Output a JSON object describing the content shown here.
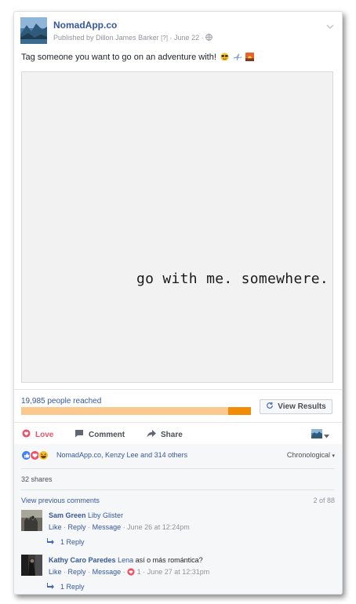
{
  "post": {
    "page_name": "NomadApp.co",
    "published_prefix": "Published by",
    "author": "Dillon James Barker",
    "author_help": "[?]",
    "date": "June 22",
    "separator": "·",
    "text": "Tag someone you want to go on an adventure with!",
    "image_caption": "go with me. somewhere."
  },
  "insights": {
    "reach_text": "19,985 people reached",
    "reach_fraction": 0.9,
    "view_results_label": "View Results"
  },
  "actions": {
    "love_label": "Love",
    "comment_label": "Comment",
    "share_label": "Share"
  },
  "feedback": {
    "reactions_text": "NomadApp.co, Kenzy Lee and 314 others",
    "order_label": "Chronological",
    "order_caret": "▾",
    "shares_text": "32 shares",
    "view_previous": "View previous comments",
    "page_count": "2 of 88"
  },
  "comments": [
    {
      "name": "Sam Green",
      "tag": "Liby Glister",
      "text": "",
      "like": "Like",
      "reply": "Reply",
      "message": "Message",
      "reaction_count": "",
      "time": "June 26 at 12:24pm",
      "replies": "1 Reply"
    },
    {
      "name": "Kathy Caro Paredes",
      "tag": "Lena",
      "text": "así o más romántica?",
      "like": "Like",
      "reply": "Reply",
      "message": "Message",
      "reaction_count": "1",
      "time": "June 27 at 12:31pm",
      "replies": "1 Reply"
    }
  ],
  "colors": {
    "link_blue": "#365899",
    "love_red": "#e9546b",
    "reach_orange": "#f28b05",
    "reach_light": "#fbc98d"
  }
}
